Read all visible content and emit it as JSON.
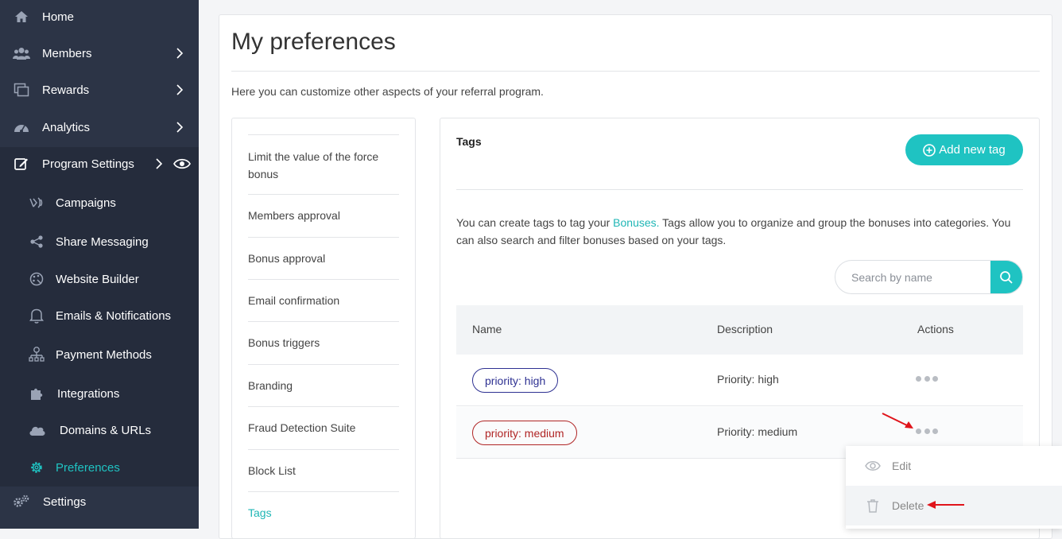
{
  "sidebar": {
    "items": [
      {
        "label": "Home",
        "icon": "home-icon"
      },
      {
        "label": "Members",
        "icon": "users-icon"
      },
      {
        "label": "Rewards",
        "icon": "rewards-icon"
      },
      {
        "label": "Analytics",
        "icon": "dashboard-icon"
      },
      {
        "label": "Program Settings",
        "icon": "edit-icon"
      },
      {
        "label": "Campaigns",
        "icon": "campaign-icon"
      },
      {
        "label": "Share Messaging",
        "icon": "share-icon"
      },
      {
        "label": "Website Builder",
        "icon": "palette-icon"
      },
      {
        "label": "Emails & Notifications",
        "icon": "bell-icon"
      },
      {
        "label": "Payment Methods",
        "icon": "payment-tree-icon"
      },
      {
        "label": "Integrations",
        "icon": "puzzle-icon"
      },
      {
        "label": "Domains & URLs",
        "icon": "cloud-icon"
      },
      {
        "label": "Preferences",
        "icon": "gear-icon"
      },
      {
        "label": "Settings",
        "icon": "gears-icon"
      }
    ],
    "active": "Preferences"
  },
  "page": {
    "title": "My preferences",
    "intro": "Here you can customize other aspects of your referral program."
  },
  "menu": {
    "items": [
      "Limit the value of the force bonus",
      "Members approval",
      "Bonus approval",
      "Email confirmation",
      "Bonus triggers",
      "Branding",
      "Fraud Detection Suite",
      "Block List",
      "Tags"
    ],
    "active": "Tags"
  },
  "tags_panel": {
    "title": "Tags",
    "add_button": "Add new tag",
    "desc_before_link": "You can create tags to tag your ",
    "desc_link": "Bonuses.",
    "desc_after_link": " Tags allow you to organize and group the bonuses into categories. You can also search and filter bonuses based on your tags.",
    "search_placeholder": "Search by name",
    "columns": [
      "Name",
      "Description",
      "Actions"
    ],
    "rows": [
      {
        "name": "priority: high",
        "description": "Priority: high",
        "color": "#2e3192"
      },
      {
        "name": "priority: medium",
        "description": "Priority: medium",
        "color": "#b02525"
      }
    ],
    "actions_menu": {
      "items": [
        "Edit",
        "Delete"
      ]
    }
  },
  "colors": {
    "accent": "#1fc3c2",
    "sidebar": "#2c3446",
    "annotation_arrow": "#e0141b"
  }
}
